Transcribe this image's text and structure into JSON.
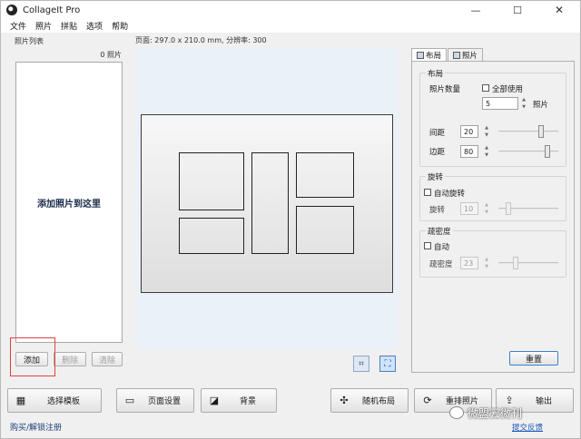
{
  "window": {
    "title": "CollageIt Pro"
  },
  "menu": [
    "文件",
    "照片",
    "拼贴",
    "选项",
    "帮助"
  ],
  "photo_list": {
    "title": "照片列表",
    "count": "0 照片",
    "drop_hint": "添加照片到这里",
    "add_label": "添加",
    "delete_label": "删除",
    "clear_label": "清除"
  },
  "page_info": "页面: 297.0 x 210.0 mm, 分辨率: 300",
  "tabs": {
    "layout": "布局",
    "photo": "照片"
  },
  "layout_group": {
    "title": "布局",
    "photo_count_label": "照片数量",
    "use_all_label": "全部使用",
    "photo_count_value": "5",
    "photo_unit": "照片",
    "spacing_label": "间距",
    "spacing_value": "20",
    "margin_label": "边距",
    "margin_value": "80"
  },
  "rotation_group": {
    "title": "旋转",
    "auto_label": "自动旋转",
    "rotate_label": "旋转",
    "rotate_value": "10"
  },
  "density_group": {
    "title": "疏密度",
    "auto_label": "自动",
    "density_label": "疏密度",
    "density_value": "23"
  },
  "reset_label": "重置",
  "bottom_buttons": {
    "template": "选择模板",
    "page_setup": "页面设置",
    "background": "背景",
    "random_layout": "随机布局",
    "shuffle": "重排照片",
    "export": "输出"
  },
  "footer": {
    "left": "购买/解锁注册",
    "link": "提交反馈"
  },
  "watermark": "微盟云微刊",
  "colors": {
    "canvas_bg": "#eaf1f9",
    "accent": "#3c7fd0",
    "highlight": "#e04040"
  }
}
